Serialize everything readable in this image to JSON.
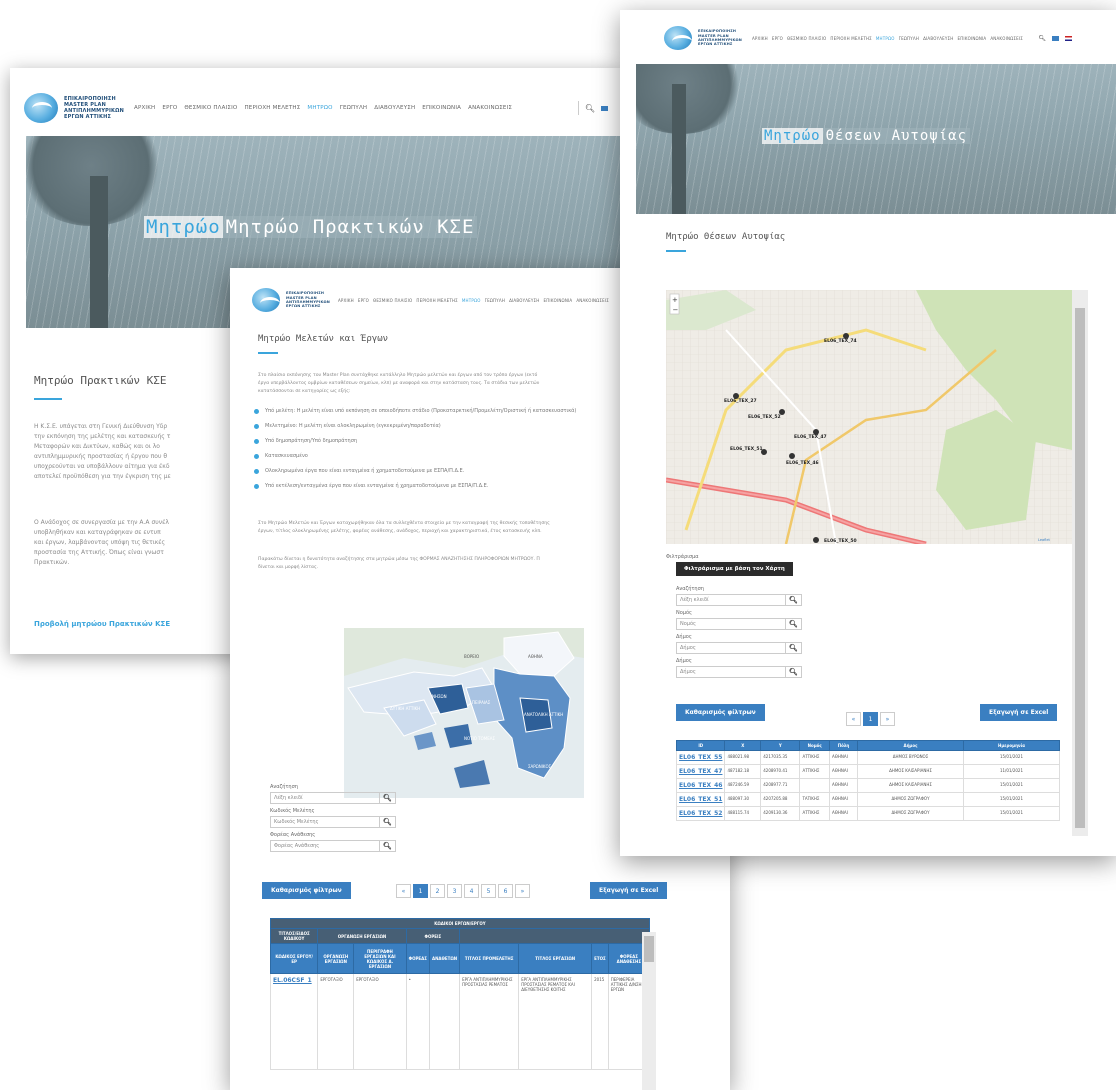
{
  "nav": {
    "logo_lines": [
      "ΕΠΙΚΑΙΡΟΠΟΙΗΣΗ",
      "MASTER PLAN",
      "ΑΝΤΙΠΛΗΜΜΥΡΙΚΩΝ",
      "ΕΡΓΩΝ ΑΤΤΙΚΗΣ"
    ],
    "items": [
      "ΑΡΧΙΚΗ",
      "ΕΡΓΟ",
      "ΘΕΣΜΙΚΟ ΠΛΑΙΣΙΟ",
      "ΠΕΡΙΟΧΗ ΜΕΛΕΤΗΣ",
      "ΜΗΤΡΩΟ",
      "ΓΕΩΠΥΛΗ",
      "ΔΙΑΒΟΥΛΕΥΣΗ",
      "ΕΠΙΚΟΙΝΩΝΙΑ",
      "ΑΝΑΚΟΙΝΩΣΕΙΣ"
    ],
    "active": "ΜΗΤΡΩΟ",
    "search_icon": "search-icon",
    "accent": "#3aa5dc"
  },
  "page_a": {
    "hero_highlight": "Μητρώο",
    "hero_rest": "Μητρώο Πρακτικών ΚΣΕ",
    "heading": "Μητρώο Πρακτικών ΚΣΕ",
    "para1": [
      "Η Κ.Σ.Ε. υπάγεται στη Γενική Διεύθυνση Υδρ",
      "την εκπόνηση της μελέτης και κατασκευής τ",
      "Μεταφορών και Δικτύων, καθώς και οι λο",
      "αντιπλημμυρικής προστασίας ή έργου που θ",
      "υποχρεούνται να υποβάλλουν αίτημα για έκδ",
      "αποτελεί προϋπόθεση για την έγκριση της με"
    ],
    "para2": [
      "Ο Ανάδοχος σε συνεργασία με την Α.Α συνέλ",
      "υποβληθήκαν και καταγράφηκαν σε εντυπ",
      "και έργων, λαμβάνοντας υπόψη τις θετικές",
      "προστασία της Αττικής. Όπως είναι γνωστ",
      "Πρακτικών."
    ],
    "link": "Προβολή μητρώου Πρακτικών ΚΣΕ"
  },
  "page_b": {
    "heading": "Μητρώο Μελετών και Έργων",
    "intro": [
      "Στο πλαίσιο εκπόνησης του Master Plan συντάχθηκε κατάλληλο Μητρώο μελετών και έργων από τον τρόπο έργων (εκτό",
      "έργα υπερβάλλοντος ομβρίων καταθέσεων σημείων, κλπ) με αναφορά και στην κατάσταση τους. Τα στάδια των μελετών",
      "κατατάσσονται σε κατηγορίες ως εξής:"
    ],
    "bullets": [
      "Υπό μελέτη: Η μελέτη είναι υπό εκπόνηση σε οποιοδήποτε στάδιο (Προκαταρκτική/Προμελέτη/Οριστική ή κατασκευαστικά)",
      "Μελετημένο: Η μελέτη είναι ολοκληρωμένη (εγκεκριμένη/παραδοτέα)",
      "Υπό δημοπράτηση/Υπό δημοπράτηση",
      "Κατασκευασμένο",
      "Ολοκληρωμένα έργα που είναι ενταγμένα ή χρηματοδοτούμενα με ΕΣΠΑ/Π.Δ.Ε.",
      "Υπό εκτέλεση/ενταγμένα έργα που είναι ενταγμένα ή χρηματοδοτούμενα με ΕΣΠΑ/Π.Δ.Ε."
    ],
    "para2": [
      "Στο Μητρώο Μελετών και Έργων καταχωρήθηκαν όλα τα συλλεχθέντα στοιχεία με την καταγραφή της θεσικής τοποθέτησης",
      "έργων, τίτλος ολοκληρωμένης μελέτης, φορέας ανάθεσης, ανάδοχος, περιοχή και χαρακτηριστικά, έτος κατασκευής κλπ."
    ],
    "para3": [
      "Παρακάτω δίνεται η δυνατότητα αναζήτησης στα μητρώα μέσω της ΦΟΡΜΑΣ ΑΝΑΖΗΤΗΣΗΣ ΠΛΗΡΟΦΟΡΙΩΝ ΜΗΤΡΩΟΥ. Π",
      "δίνεται και μορφή λίστας."
    ],
    "map_labels": [
      "ΑΘΗΝΑ",
      "ΔΥΤΙΚΗ ΑΤΤΙΚΗ",
      "ΝΗΣΩΝ",
      "ΠΕΙΡΑΙΑΣ",
      "ΑΝΑΤΟΛΙΚΗ ΑΤΤΙΚΗ",
      "ΝΟΤΙΟ ΤΟΜΕΑΣ",
      "ΣΑΡΩΝΙΚΟΣ",
      "ΒΟΡΕΙΟ"
    ],
    "filters": [
      {
        "label": "Αναζήτηση",
        "placeholder": "Λέξη κλειδί"
      },
      {
        "label": "Κωδικός Μελέτης",
        "placeholder": "Κωδικός Μελέτης"
      },
      {
        "label": "Φορέας Ανάθεσης",
        "placeholder": "Φορέας Ανάθεσης"
      }
    ],
    "clear_button": "Καθαρισμός φίλτρων",
    "export_button": "Εξαγωγή σε Excel",
    "pager": [
      "«",
      "1",
      "2",
      "3",
      "4",
      "5",
      "6",
      "»"
    ],
    "table": {
      "group_header": "ΚΩΔΙΚΟΙ ΕΡΓΩΝ/ΕΡΓΟΥ",
      "sub_headers": [
        "ΤΙΤΛΟΣ/ΕΙΔΟΣ ΚΩΔΙΚΟΥ",
        "ΟΡΓΑΝΩΣΗ ΕΡΓΑΣΙΩΝ",
        "ΦΟΡΕΙΣ"
      ],
      "columns": [
        "ΚΩΔΙΚΟΣ ΕΡΓΟΥ/ΕΡ",
        "ΟΡΓΑΝΩΣΗ ΕΡΓΑΣΙΩΝ",
        "ΠΕΡΙΓΡΑΦΗ ΕΡΓΑΣΙΩΝ ΚΑΙ ΚΩΔΙΚΟΣ Α. ΕΡΓΑΣΙΩΝ",
        "ΦΟΡΕΑΣ",
        "ΑΝΑΘΕΤΩΝ",
        "ΤΙΤΛΟΣ ΠΡΟΜΕΛΕΤΗΣ",
        "ΤΙΤΛΟΣ ΕΡΓΑΣΙΩΝ",
        "ΕΤΟΣ",
        "ΦΟΡΕΑΣ ΑΝΑΘΕΣΗΣ"
      ],
      "row": [
        "EL.06CSF_1",
        "ΕΡΓΟΤΑΞΙΟ",
        "ΕΡΓΟΤΑΞΙΟ",
        "•",
        "",
        "ΕΡΓΑ ΑΝΤΙΠΛΗΜΜΥΡΙΚΗΣ ΠΡΟΣΤΑΣΙΑΣ ΡΕΜΑΤΟΣ",
        "ΕΡΓΑ ΑΝΤΙΠΛΗΜΜΥΡΙΚΗΣ ΠΡΟΣΤΑΣΙΑΣ ΡΕΜΑΤΟΣ ΚΑΙ ΔΙΕΥΘΕΤΗΣΗΣ ΚΟΙΤΗΣ",
        "2015",
        "ΠΕΡΙΦΕΡΕΙΑ ΑΤΤΙΚΗΣ Δ/ΝΣΗ ΕΡΓΩΝ"
      ]
    }
  },
  "page_c": {
    "hero_highlight": "Μητρώο",
    "hero_rest": "Θέσεων Αυτοψίας",
    "heading": "Μητρώο Θέσεων Αυτοψίας",
    "map_markers": [
      "EL06_TEX_74",
      "EL06_TEX_27",
      "EL06_TEX_52",
      "EL06_TEX_47",
      "EL06_TEX_51",
      "EL06_TEX_46",
      "EL06_TEX_50"
    ],
    "map_attribution": "Leaflet",
    "filter_label": "Φιλτράρισμα",
    "filter_map_button": "Φιλτράρισμα με βάση τον Χάρτη",
    "filters": [
      {
        "label": "Αναζήτηση",
        "placeholder": "Λέξη κλειδί"
      },
      {
        "label": "Νομός",
        "placeholder": "Νομός"
      },
      {
        "label": "Δήμος",
        "placeholder": "Δήμος"
      },
      {
        "label": "Δήμος",
        "placeholder": "Δήμος"
      }
    ],
    "clear_button": "Καθαρισμός φίλτρων",
    "export_button": "Εξαγωγή σε Excel",
    "pager": [
      "«",
      "1",
      "»"
    ],
    "table": {
      "columns": [
        "ID",
        "X",
        "Y",
        "Νομός",
        "Πόλη",
        "Δήμος",
        "Ημερομηνία"
      ],
      "rows": [
        [
          "EL06_TEX_55",
          "488021.98",
          "4217035.35",
          "ΑΤΤΙΚΗΣ",
          "ΑΘΗΝΑΙ",
          "ΔΗΜΟΣ ΒΥΡΩΝΟΣ",
          "15/01/2021"
        ],
        [
          "EL06_TEX_47",
          "487182.18",
          "4208970.41",
          "ΑΤΤΙΚΗΣ",
          "ΑΘΗΝΑΙ",
          "ΔΗΜΟΣ ΚΑΙΣΑΡΙΑΝΗΣ",
          "11/01/2021"
        ],
        [
          "EL06_TEX_46",
          "487246.59",
          "4208977.71",
          "",
          "ΑΘΗΝΑΙ",
          "ΔΗΜΟΣ ΚΑΙΣΑΡΙΑΝΗΣ",
          "15/01/2021"
        ],
        [
          "EL06_TEX_51",
          "488097.30",
          "4207205.88",
          "ΤΑΤΙΚΗΣ",
          "ΑΘΗΝΑΙ",
          "ΔΗΜΟΣ ΖΩΓΡΑΦΟΥ",
          "15/01/2021"
        ],
        [
          "EL06_TEX_52",
          "488115.74",
          "4209130.36",
          "ΑΤΤΙΚΗΣ",
          "ΑΘΗΝΑΙ",
          "ΔΗΜΟΣ ΖΩΓΡΑΦΟΥ",
          "15/01/2021"
        ]
      ]
    }
  }
}
